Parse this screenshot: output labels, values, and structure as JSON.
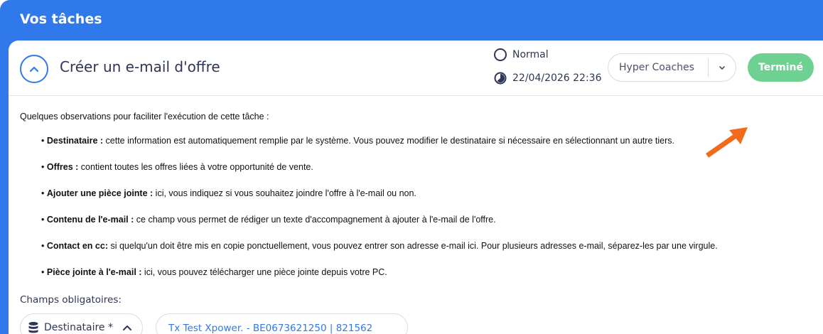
{
  "panel": {
    "title": "Vos tâches"
  },
  "task": {
    "title": "Créer un e-mail d'offre",
    "priority": "Normal",
    "due_date": "22/04/2026 22:36",
    "assignee": "Hyper Coaches",
    "done_label": "Terminé"
  },
  "notes": {
    "intro": "Quelques observations pour faciliter l'exécution de cette tâche :",
    "items": [
      {
        "term": "Destinataire :",
        "text": " cette information est automatiquement remplie par le système. Vous pouvez modifier le destinataire si nécessaire en sélectionnant un autre tiers."
      },
      {
        "term": "Offres :",
        "text": " contient toutes les offres liées à votre opportunité de vente."
      },
      {
        "term": "Ajouter une pièce jointe :",
        "text": " ici, vous indiquez si vous souhaitez joindre l'offre à l'e-mail ou non."
      },
      {
        "term": "Contenu de l'e-mail :",
        "text": " ce champ vous permet de rédiger un texte d'accompagnement à ajouter à l'e-mail de l'offre."
      },
      {
        "term": "Contact en cc:",
        "text": "  si quelqu'un doit être mis en copie ponctuellement, vous pouvez entrer son adresse e-mail ici. Pour plusieurs adresses e-mail, séparez-les par une virgule."
      },
      {
        "term": "Pièce jointe à l'e-mail :",
        "text": " ici, vous pouvez télécharger une pièce jointe depuis votre PC."
      }
    ]
  },
  "required": {
    "label": "Champs obligatoires:",
    "field_label": "Destinataire *",
    "field_value": "Tx Test Xpower. - BE0673621250 | 821562"
  },
  "colors": {
    "primary": "#3079ea",
    "success": "#6ed192",
    "arrow": "#f26a1b",
    "text_dark": "#2e3557"
  },
  "icons": [
    "chevron-up-icon",
    "priority-circle-icon",
    "clock-icon",
    "chevron-down-icon",
    "arrow-annotation",
    "database-icon"
  ]
}
